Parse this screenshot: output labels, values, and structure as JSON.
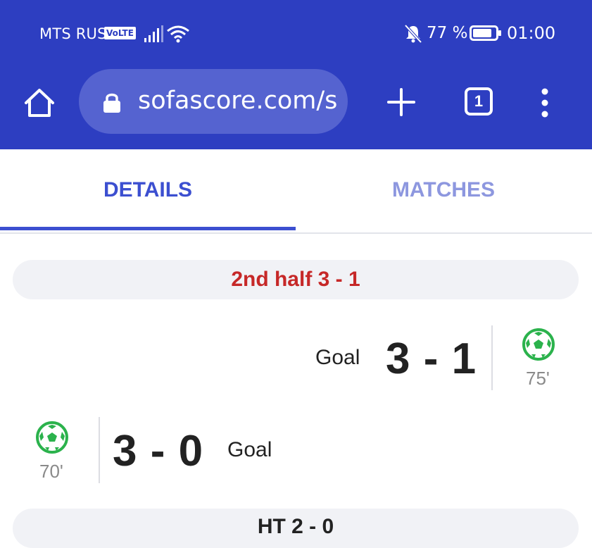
{
  "status_bar": {
    "carrier": "MTS RUS",
    "volte": "VoLTE",
    "battery_percent": "77 %",
    "time": "01:00",
    "icons": [
      "signal-icon",
      "wifi-icon",
      "bell-muted-icon",
      "battery-icon"
    ]
  },
  "browser": {
    "url": "sofascore.com/s",
    "tab_count": "1",
    "icons": [
      "home-icon",
      "lock-icon",
      "plus-icon",
      "tabs-icon",
      "menu-icon"
    ]
  },
  "tabs": [
    {
      "label": "DETAILS",
      "active": true
    },
    {
      "label": "MATCHES",
      "active": false
    }
  ],
  "incidents": {
    "period_1": "2nd half 3 - 1",
    "event_1": {
      "label": "Goal",
      "score": "3 - 1",
      "minute": "75'",
      "side": "away"
    },
    "event_2": {
      "label": "Goal",
      "score": "3 - 0",
      "minute": "70'",
      "side": "home"
    },
    "period_2": "HT 2 - 0"
  },
  "colors": {
    "header_bg": "#2d3ec1",
    "accent": "#3c4fd0",
    "period_red": "#c62828",
    "goal_green": "#2bb24c"
  }
}
